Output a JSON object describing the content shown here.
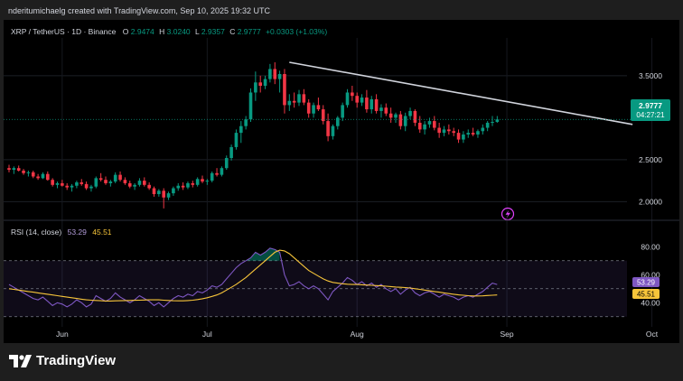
{
  "header": {
    "publisher_text": "nderitumichaelg created with TradingView.com, Sep 10, 2025 19:32 UTC"
  },
  "symbol_bar": {
    "symbol": "XRP / TetherUS · 1D · Binance",
    "open_label": "O",
    "open": "2.9474",
    "high_label": "H",
    "high": "3.0240",
    "low_label": "L",
    "low": "2.9357",
    "close_label": "C",
    "close": "2.9777",
    "change": "+0.0303 (+1.03%)"
  },
  "price_tag": {
    "price": "2.9777",
    "countdown": "04:27:21"
  },
  "rsi": {
    "label": "RSI (14, close)",
    "value": "53.29",
    "ma_value": "45.51"
  },
  "footer": {
    "brand": "TradingView"
  },
  "colors": {
    "up": "#089981",
    "down": "#f23645",
    "rsi_line": "#7e57c2",
    "rsi_ma": "#f7c53a",
    "trendline": "#d1d4dc",
    "price_tag": "#089981"
  },
  "chart_data": [
    {
      "type": "candlestick",
      "title": "XRP / TetherUS · 1D · Binance",
      "x_ticks": [
        "Jun",
        "Jul",
        "Aug",
        "Sep",
        "Oct"
      ],
      "y_ticks": [
        "2.0000",
        "2.5000",
        "3.5000"
      ],
      "ylim": [
        1.8,
        3.95
      ],
      "date_range": [
        "2025-05-21",
        "2025-09-10"
      ],
      "trendline": {
        "from": [
          "2025-07-18",
          3.66
        ],
        "to": [
          "2025-09-27",
          2.92
        ],
        "color": "#d1d4dc"
      },
      "candles_ohlc": [
        [
          2.4,
          2.44,
          2.35,
          2.38
        ],
        [
          2.38,
          2.42,
          2.33,
          2.4
        ],
        [
          2.4,
          2.43,
          2.36,
          2.37
        ],
        [
          2.37,
          2.39,
          2.32,
          2.34
        ],
        [
          2.34,
          2.37,
          2.3,
          2.35
        ],
        [
          2.35,
          2.37,
          2.28,
          2.3
        ],
        [
          2.3,
          2.33,
          2.26,
          2.28
        ],
        [
          2.28,
          2.35,
          2.27,
          2.33
        ],
        [
          2.33,
          2.36,
          2.25,
          2.26
        ],
        [
          2.26,
          2.28,
          2.18,
          2.2
        ],
        [
          2.2,
          2.24,
          2.16,
          2.22
        ],
        [
          2.22,
          2.26,
          2.18,
          2.19
        ],
        [
          2.19,
          2.22,
          2.14,
          2.17
        ],
        [
          2.17,
          2.21,
          2.12,
          2.19
        ],
        [
          2.19,
          2.25,
          2.16,
          2.23
        ],
        [
          2.23,
          2.27,
          2.19,
          2.21
        ],
        [
          2.21,
          2.24,
          2.14,
          2.16
        ],
        [
          2.16,
          2.2,
          2.12,
          2.18
        ],
        [
          2.18,
          2.3,
          2.16,
          2.28
        ],
        [
          2.28,
          2.34,
          2.24,
          2.26
        ],
        [
          2.26,
          2.3,
          2.2,
          2.22
        ],
        [
          2.22,
          2.26,
          2.18,
          2.24
        ],
        [
          2.24,
          2.35,
          2.22,
          2.32
        ],
        [
          2.32,
          2.36,
          2.24,
          2.26
        ],
        [
          2.26,
          2.29,
          2.2,
          2.22
        ],
        [
          2.22,
          2.25,
          2.16,
          2.18
        ],
        [
          2.18,
          2.22,
          2.14,
          2.2
        ],
        [
          2.2,
          2.28,
          2.18,
          2.25
        ],
        [
          2.25,
          2.29,
          2.18,
          2.2
        ],
        [
          2.2,
          2.23,
          2.14,
          2.16
        ],
        [
          2.16,
          2.18,
          2.06,
          2.09
        ],
        [
          2.09,
          2.15,
          2.06,
          2.13
        ],
        [
          2.13,
          2.16,
          1.92,
          2.05
        ],
        [
          2.05,
          2.12,
          2.02,
          2.1
        ],
        [
          2.1,
          2.18,
          2.07,
          2.16
        ],
        [
          2.16,
          2.22,
          2.13,
          2.19
        ],
        [
          2.19,
          2.23,
          2.14,
          2.17
        ],
        [
          2.17,
          2.24,
          2.15,
          2.22
        ],
        [
          2.22,
          2.25,
          2.17,
          2.2
        ],
        [
          2.2,
          2.29,
          2.18,
          2.27
        ],
        [
          2.27,
          2.31,
          2.22,
          2.24
        ],
        [
          2.24,
          2.27,
          2.2,
          2.25
        ],
        [
          2.25,
          2.36,
          2.23,
          2.34
        ],
        [
          2.34,
          2.4,
          2.3,
          2.32
        ],
        [
          2.32,
          2.42,
          2.3,
          2.4
        ],
        [
          2.4,
          2.55,
          2.38,
          2.52
        ],
        [
          2.52,
          2.68,
          2.49,
          2.65
        ],
        [
          2.65,
          2.86,
          2.62,
          2.82
        ],
        [
          2.82,
          2.96,
          2.7,
          2.9
        ],
        [
          2.9,
          3.02,
          2.86,
          2.98
        ],
        [
          2.98,
          3.35,
          2.95,
          3.3
        ],
        [
          3.3,
          3.55,
          3.2,
          3.42
        ],
        [
          3.42,
          3.5,
          3.3,
          3.38
        ],
        [
          3.38,
          3.5,
          3.34,
          3.46
        ],
        [
          3.46,
          3.64,
          3.42,
          3.58
        ],
        [
          3.58,
          3.66,
          3.4,
          3.46
        ],
        [
          3.46,
          3.56,
          3.3,
          3.52
        ],
        [
          3.52,
          3.58,
          3.05,
          3.15
        ],
        [
          3.15,
          3.28,
          3.08,
          3.2
        ],
        [
          3.2,
          3.3,
          3.12,
          3.18
        ],
        [
          3.18,
          3.33,
          3.14,
          3.28
        ],
        [
          3.28,
          3.34,
          3.15,
          3.18
        ],
        [
          3.18,
          3.22,
          3.0,
          3.05
        ],
        [
          3.05,
          3.18,
          3.0,
          3.15
        ],
        [
          3.15,
          3.24,
          3.08,
          3.1
        ],
        [
          3.1,
          3.15,
          2.92,
          2.96
        ],
        [
          2.96,
          3.05,
          2.72,
          2.78
        ],
        [
          2.78,
          2.92,
          2.74,
          2.9
        ],
        [
          2.9,
          3.02,
          2.86,
          3.0
        ],
        [
          3.0,
          3.18,
          2.96,
          3.15
        ],
        [
          3.15,
          3.34,
          3.12,
          3.3
        ],
        [
          3.3,
          3.38,
          3.2,
          3.26
        ],
        [
          3.26,
          3.3,
          3.12,
          3.18
        ],
        [
          3.18,
          3.28,
          3.14,
          3.24
        ],
        [
          3.24,
          3.33,
          3.06,
          3.1
        ],
        [
          3.1,
          3.26,
          3.05,
          3.22
        ],
        [
          3.22,
          3.28,
          3.05,
          3.08
        ],
        [
          3.08,
          3.16,
          3.0,
          3.12
        ],
        [
          3.12,
          3.17,
          3.02,
          3.05
        ],
        [
          3.05,
          3.12,
          2.94,
          3.0
        ],
        [
          3.0,
          3.06,
          2.94,
          3.04
        ],
        [
          3.04,
          3.08,
          2.86,
          2.9
        ],
        [
          2.9,
          3.06,
          2.84,
          3.02
        ],
        [
          3.02,
          3.12,
          2.98,
          3.08
        ],
        [
          3.08,
          3.1,
          2.9,
          2.94
        ],
        [
          2.94,
          3.02,
          2.82,
          2.86
        ],
        [
          2.86,
          2.96,
          2.8,
          2.92
        ],
        [
          2.92,
          3.0,
          2.88,
          2.96
        ],
        [
          2.96,
          3.02,
          2.85,
          2.88
        ],
        [
          2.88,
          2.94,
          2.76,
          2.82
        ],
        [
          2.82,
          2.9,
          2.78,
          2.86
        ],
        [
          2.86,
          2.92,
          2.8,
          2.84
        ],
        [
          2.84,
          2.88,
          2.78,
          2.82
        ],
        [
          2.82,
          2.86,
          2.7,
          2.74
        ],
        [
          2.74,
          2.84,
          2.7,
          2.8
        ],
        [
          2.8,
          2.86,
          2.76,
          2.82
        ],
        [
          2.82,
          2.88,
          2.78,
          2.8
        ],
        [
          2.8,
          2.86,
          2.76,
          2.84
        ],
        [
          2.84,
          2.92,
          2.8,
          2.88
        ],
        [
          2.88,
          2.96,
          2.84,
          2.94
        ],
        [
          2.94,
          3.02,
          2.9,
          2.95
        ],
        [
          2.95,
          3.02,
          2.94,
          2.98
        ]
      ]
    },
    {
      "type": "line",
      "title": "RSI (14, close)",
      "y_ticks": [
        "40.00",
        "60.00",
        "80.00"
      ],
      "ylim": [
        15,
        95
      ],
      "bands": [
        30,
        50,
        70
      ],
      "series": [
        {
          "name": "RSI",
          "color": "#7e57c2",
          "values": [
            53,
            51,
            49,
            47,
            45,
            43,
            42,
            44,
            41,
            38,
            40,
            39,
            37,
            39,
            42,
            40,
            37,
            39,
            45,
            43,
            41,
            43,
            47,
            44,
            42,
            40,
            42,
            45,
            43,
            41,
            38,
            40,
            37,
            40,
            43,
            45,
            44,
            46,
            45,
            48,
            47,
            49,
            52,
            51,
            53,
            57,
            61,
            65,
            68,
            70,
            72,
            76,
            74,
            76,
            79,
            78,
            76,
            60,
            52,
            53,
            55,
            52,
            50,
            52,
            50,
            46,
            42,
            48,
            51,
            54,
            58,
            56,
            53,
            55,
            52,
            54,
            51,
            53,
            50,
            48,
            50,
            46,
            49,
            51,
            47,
            45,
            47,
            48,
            46,
            44,
            46,
            45,
            44,
            42,
            44,
            45,
            44,
            46,
            48,
            51,
            54,
            53
          ]
        },
        {
          "name": "MA",
          "color": "#f7c53a",
          "values": [
            50,
            49.5,
            49,
            48.5,
            48,
            47.5,
            47,
            46.5,
            46,
            45.5,
            45,
            44.5,
            44,
            43.5,
            43,
            42.5,
            42,
            41.8,
            41.6,
            41.4,
            41.2,
            41.2,
            41.3,
            41.4,
            41.5,
            41.6,
            41.7,
            41.8,
            41.9,
            42,
            42,
            42,
            41.8,
            41.6,
            41.4,
            41.3,
            41.3,
            41.5,
            41.8,
            42.2,
            42.8,
            43.5,
            44.5,
            45.5,
            47,
            49,
            51,
            53,
            55.5,
            58,
            61,
            64,
            67,
            70,
            73,
            76,
            77.5,
            77,
            75,
            72,
            69,
            66,
            63,
            61,
            59,
            57,
            55.5,
            54.5,
            54,
            53.5,
            53.2,
            53,
            53,
            52.8,
            52.6,
            52.4,
            52.2,
            52,
            51.8,
            51.5,
            51.2,
            51,
            50.8,
            50.5,
            50,
            49.5,
            49,
            48.5,
            48,
            47.5,
            47,
            46.5,
            46,
            45.6,
            45.3,
            45,
            44.8,
            44.8,
            44.9,
            45.1,
            45.3,
            45.51
          ]
        }
      ]
    }
  ]
}
